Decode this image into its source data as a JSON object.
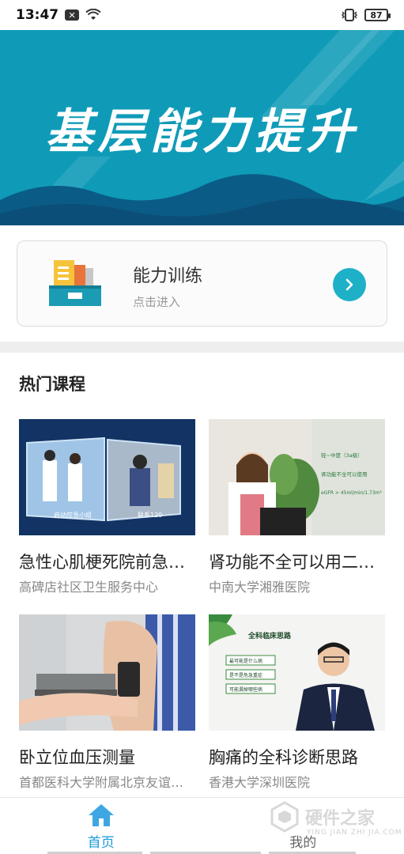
{
  "status_bar": {
    "time": "13:47",
    "battery": "87"
  },
  "banner": {
    "title": "基层能力提升"
  },
  "training_card": {
    "title": "能力训练",
    "subtitle": "点击进入"
  },
  "section": {
    "title": "热门课程"
  },
  "courses": [
    {
      "title": "急性心肌梗死院前急…",
      "org": "高碑店社区卫生服务中心"
    },
    {
      "title": "肾功能不全可以用二…",
      "org": "中南大学湘雅医院"
    },
    {
      "title": "卧立位血压测量",
      "org": "首都医科大学附属北京友谊…"
    },
    {
      "title": "胸痛的全科诊断思路",
      "org": "香港大学深圳医院"
    }
  ],
  "thumb_text": {
    "c1_left": "启动应急小组",
    "c1_right": "联系120",
    "c2_lines": [
      "轻~中度（3a级）",
      "肾功能不全可以使用",
      "eGFR > 45ml/min/1.73m²"
    ],
    "c4_heading": "全科临床思路",
    "c4_items": [
      "最可能是什么病",
      "是不是危急重症",
      "可能漏掉哪些病"
    ]
  },
  "tabbar": {
    "home_label": "首页",
    "mine_label": "我的"
  },
  "watermark": {
    "text": "硬件之家",
    "sub": "YING JIAN ZHI JIA.COM"
  },
  "colors": {
    "accent": "#1eb0c7",
    "banner": "#0f9bb8",
    "tab_active": "#1a9bd6"
  }
}
